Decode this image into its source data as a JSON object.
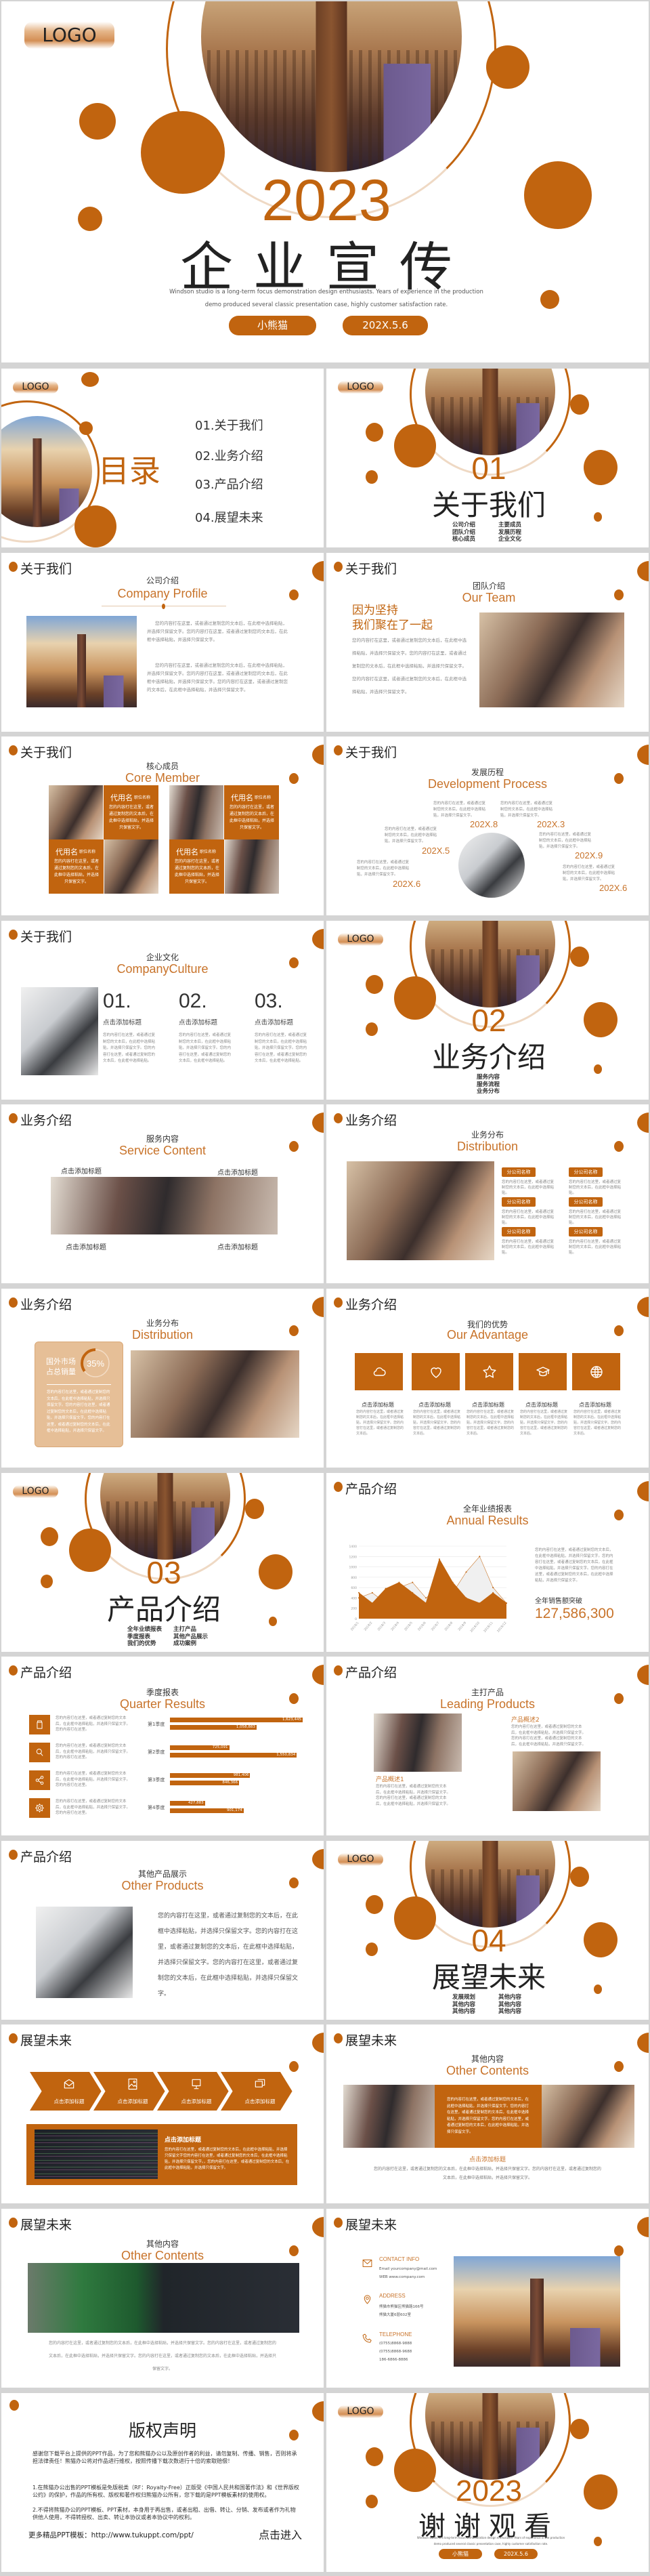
{
  "colors": {
    "accent": "#c1640f",
    "peach": "#e6bf97",
    "text": "#333333",
    "muted": "#8a8a8a"
  },
  "cover": {
    "logo": "LOGO",
    "year": "2023",
    "title": "企业宣传",
    "desc1": "Windson studio is a long-term focus demonstration design enthusiasts. Years of experience in the production",
    "desc2": "demo produced several classic presentation case, highly customer satisfaction rate.",
    "author": "小熊猫",
    "date": "202X.5.6"
  },
  "toc": {
    "logo": "LOGO",
    "title": "目录",
    "items": [
      "01.关于我们",
      "02.业务介绍",
      "03.产品介绍",
      "04.展望未来"
    ]
  },
  "sections": [
    {
      "logo": "LOGO",
      "number": "01",
      "title": "关于我们",
      "items": [
        "公司介绍",
        "团队介绍",
        "核心成员",
        "主要成员",
        "发展历程",
        "企业文化"
      ]
    },
    {
      "logo": "LOGO",
      "number": "02",
      "title": "业务介绍",
      "items": [
        "服务内容",
        "服务流程",
        "业务分布"
      ]
    },
    {
      "logo": "LOGO",
      "number": "03",
      "title": "产品介绍",
      "items": [
        "全年业绩报表",
        "季度报表",
        "我们的优势",
        "主打产品",
        "其他产品展示",
        "成功案例"
      ]
    },
    {
      "logo": "LOGO",
      "number": "04",
      "title": "展望未来",
      "items": [
        "发展规划",
        "其他内容",
        "其他内容",
        "其他内容",
        "其他内容",
        "其他内容"
      ]
    }
  ],
  "slides": {
    "company_profile": {
      "header": "关于我们",
      "cn": "公司介绍",
      "en": "Company Profile",
      "para1": "您的内容打在这里，或者通过复制您的文本后，在此框中选择粘贴，并选择只保留文字。您的内容打在这里，或者通过复制您的文本后，在此框中选择粘贴，并选择只保留文字。",
      "para2": "您的内容打在这里，或者通过复制您的文本后，在此框中选择粘贴，并选择只保留文字。您的内容打在这里，或者通过复制您的文本后，在此框中选择粘贴，并选择只保留文字。您的内容打在这里，或者通过复制您的文本后，在此框中选择粘贴，并选择只保留文字。"
    },
    "team": {
      "header": "关于我们",
      "cn": "团队介绍",
      "en": "Our Team",
      "slogan1": "因为坚持",
      "slogan2": "我们聚在了一起",
      "text": "您的内容打在这里，或者通过复制您的文本后，在此框中选择粘贴，并选择只保留文字。您的内容打在这里，或者通过复制您的文本后，在此框中选择粘贴，并选择只保留文字。您的内容打在这里，或者通过复制您的文本后，在此框中选择粘贴，并选择只保留文字。"
    },
    "core": {
      "header": "关于我们",
      "cn": "核心成员",
      "en": "Core Member",
      "members": [
        {
          "name": "代用名",
          "role": "职位名称",
          "text": "您的内容打在这里，或者通过复制您的文本后，在此框中选择粘贴，并选择只保留文字。"
        },
        {
          "name": "代用名",
          "role": "职位名称",
          "text": "您的内容打在这里，或者通过复制您的文本后，在此框中选择粘贴，并选择只保留文字。"
        },
        {
          "name": "代用名",
          "role": "职位名称",
          "text": "您的内容打在这里，或者通过复制您的文本后，在此框中选择粘贴，并选择只保留文字。"
        },
        {
          "name": "代用名",
          "role": "职位名称",
          "text": "您的内容打在这里，或者通过复制您的文本后，在此框中选择粘贴，并选择只保留文字。"
        }
      ]
    },
    "process": {
      "header": "关于我们",
      "cn": "发展历程",
      "en": "Development Process",
      "events": [
        {
          "date": "202X.8",
          "text": "您的内容打在这里，或者通过复制您的文本后，在此框中选择粘贴，并选择只保留文字。"
        },
        {
          "date": "202X.3",
          "text": "您的内容打在这里，或者通过复制您的文本后，在此框中选择粘贴，并选择只保留文字。"
        },
        {
          "date": "202X.5",
          "text": "您的内容打在这里，或者通过复制您的文本后，在此框中选择粘贴，并选择只保留文字。"
        },
        {
          "date": "202X.9",
          "text": "您的内容打在这里，或者通过复制您的文本后，在此框中选择粘贴，并选择只保留文字。"
        },
        {
          "date": "202X.6",
          "text": "您的内容打在这里，或者通过复制您的文本后，在此框中选择粘贴，并选择只保留文字。"
        },
        {
          "date": "202X.6",
          "text": "您的内容打在这里，或者通过复制您的文本后，在此框中选择粘贴，并选择只保留文字。"
        }
      ]
    },
    "culture": {
      "header": "关于我们",
      "cn": "企业文化",
      "en": "CompanyCulture",
      "items": [
        {
          "num": "01.",
          "title": "点击添加标题",
          "text": "您的内容打在这里，或者通过复制您的文本后，在此框中选择粘贴，并选择只保留文字。您的内容打在这里，或者通过复制您的文本后，在此框中选择粘贴。"
        },
        {
          "num": "02.",
          "title": "点击添加标题",
          "text": "您的内容打在这里，或者通过复制您的文本后，在此框中选择粘贴，并选择只保留文字。您的内容打在这里，或者通过复制您的文本后，在此框中选择粘贴。"
        },
        {
          "num": "03.",
          "title": "点击添加标题",
          "text": "您的内容打在这里，或者通过复制您的文本后，在此框中选择粘贴，并选择只保留文字。您的内容打在这里，或者通过复制您的文本后，在此框中选择粘贴。"
        }
      ]
    },
    "service": {
      "header": "业务介绍",
      "cn": "服务内容",
      "en": "Service Content",
      "labels": [
        "点击添加标题",
        "点击添加标题",
        "点击添加标题",
        "点击添加标题"
      ]
    },
    "dist1": {
      "header": "业务介绍",
      "cn": "业务分布",
      "en": "Distribution",
      "branches": [
        {
          "tag": "分公司名称",
          "text": "您的内容打在这里，或者通过复制您的文本后，在此框中选择粘贴。"
        },
        {
          "tag": "分公司名称",
          "text": "您的内容打在这里，或者通过复制您的文本后，在此框中选择粘贴。"
        },
        {
          "tag": "分公司名称",
          "text": "您的内容打在这里，或者通过复制您的文本后，在此框中选择粘贴。"
        },
        {
          "tag": "分公司名称",
          "text": "您的内容打在这里，或者通过复制您的文本后，在此框中选择粘贴。"
        },
        {
          "tag": "分公司名称",
          "text": "您的内容打在这里，或者通过复制您的文本后，在此框中选择粘贴。"
        },
        {
          "tag": "分公司名称",
          "text": "您的内容打在这里，或者通过复制您的文本后，在此框中选择粘贴。"
        }
      ]
    },
    "dist2": {
      "header": "业务介绍",
      "cn": "业务分布",
      "en": "Distribution",
      "label1": "国外市场",
      "label2": "占总销量",
      "percent": "35%",
      "percent_value": 35,
      "text": "您的内容打在这里，或者通过复制您的文本后，在此框中选择粘贴，并选择只保留文字。您的内容打在这里，或者通过复制您的文本后，在此框中选择粘贴，并选择只保留文字。您的内容打在这里，或者通过复制您的文本后，在此框中选择粘贴，并选择只保留文字。"
    },
    "advantage": {
      "header": "业务介绍",
      "cn": "我们的优势",
      "en": "Our Advantage",
      "items": [
        {
          "icon": "cloud-icon",
          "title": "点击添加标题",
          "text": "您的内容打在这里，或者通过复制您的文本后，在此框中选择粘贴，并选择只保留文字。您的内容打在这里，或者通过复制您的文本后。"
        },
        {
          "icon": "heart-icon",
          "title": "点击添加标题",
          "text": "您的内容打在这里，或者通过复制您的文本后，在此框中选择粘贴，并选择只保留文字。您的内容打在这里，或者通过复制您的文本后。"
        },
        {
          "icon": "star-icon",
          "title": "点击添加标题",
          "text": "您的内容打在这里，或者通过复制您的文本后，在此框中选择粘贴，并选择只保留文字。您的内容打在这里，或者通过复制您的文本后。"
        },
        {
          "icon": "graduation-cap-icon",
          "title": "点击添加标题",
          "text": "您的内容打在这里，或者通过复制您的文本后，在此框中选择粘贴，并选择只保留文字。您的内容打在这里，或者通过复制您的文本后。"
        },
        {
          "icon": "globe-icon",
          "title": "点击添加标题",
          "text": "您的内容打在这里，或者通过复制您的文本后，在此框中选择粘贴，并选择只保留文字。您的内容打在这里，或者通过复制您的文本后。"
        }
      ]
    },
    "annual": {
      "header": "产品介绍",
      "cn": "全年业绩报表",
      "en": "Annual Results",
      "text": "您的内容打在这里，或者通过复制您的文本后，在此框中选择粘贴，并选择只保留文字。您的内容打在这里，或者通过复制您的文本后，在此框中选择粘贴，并选择只保留文字。您的内容打在这里，或者通过复制您的文本后，在此框中选择粘贴，并选择只保留文字。",
      "sales_label": "全年销售额突破",
      "sales_value": "127,586,300"
    },
    "quarter": {
      "header": "产品介绍",
      "cn": "季度报表",
      "en": "Quarter Results",
      "rows": [
        {
          "icon": "jar-icon",
          "text": "您的内容打在这里，或者通过复制您的文本后，在此框中选择粘贴，并选择只保留文字。您的内容打在这里。",
          "label": "第1季度",
          "a": "1,623,445",
          "b": "1,058,883"
        },
        {
          "icon": "search-icon",
          "text": "您的内容打在这里，或者通过复制您的文本后，在此框中选择粘贴，并选择只保留文字。您的内容打在这里。",
          "label": "第2季度",
          "a": "725,091",
          "b": "1,550,834"
        },
        {
          "icon": "share-icon",
          "text": "您的内容打在这里，或者通过复制您的文本后，在此框中选择粘贴，并选择只保留文字。您的内容打在这里。",
          "label": "第3季度",
          "a": "981,406",
          "b": "846,366"
        },
        {
          "icon": "gear-icon",
          "text": "您的内容打在这里，或者通过复制您的文本后，在此框中选择粘贴，并选择只保留文字。您的内容打在这里。",
          "label": "第4季度",
          "a": "427,883",
          "b": "901,174"
        }
      ]
    },
    "leading": {
      "header": "产品介绍",
      "cn": "主打产品",
      "en": "Leading Products",
      "p1_title": "产品概述1",
      "p1_text": "您的内容打在这里，或者通过复制您的文本后，在此框中选择粘贴，并选择只保留文字。您的内容打在这里，或者通过复制您的文本后，在此框中选择粘贴，并选择只保留文字。",
      "p2_title": "产品概述2",
      "p2_text": "您的内容打在这里，或者通过复制您的文本后，在此框中选择粘贴，并选择只保留文字。您的内容打在这里，或者通过复制您的文本后，在此框中选择粘贴，并选择只保留文字。"
    },
    "other_products": {
      "header": "产品介绍",
      "cn": "其他产品展示",
      "en": "Other Products",
      "text": "您的内容打在这里，或者通过复制您的文本后，在此框中选择粘贴，并选择只保留文字。您的内容打在这里，或者通过复制您的文本后，在此框中选择粘贴，并选择只保留文字。您的内容打在这里，或者通过复制您的文本后，在此框中选择粘贴，并选择只保留文字。"
    },
    "future_steps": {
      "header": "展望未来",
      "steps": [
        {
          "icon": "mail-icon",
          "label": "点击添加标题"
        },
        {
          "icon": "image-icon",
          "label": "点击添加标题"
        },
        {
          "icon": "monitor-icon",
          "label": "点击添加标题"
        },
        {
          "icon": "chat-icon",
          "label": "点击添加标题"
        }
      ],
      "box_title": "点击添加标题",
      "box_text": "您的内容打在这里，或者通过复制您的文本后，在此框中选择粘贴，并选择只保留文字您的内容打在这里，或者通过复制您的文本后，在此框中选择粘贴，并选择只保留文字。，您的内容打在这里，或者通过复制您的文本后，在此框中选择粘贴，并选择只保留文字。"
    },
    "other_contents1": {
      "header": "展望未来",
      "cn": "其他内容",
      "en": "Other Contents",
      "card_text": "您的内容打在这里，或者通过复制您的文本后，在此框中选择粘贴，并选择只保留文字。您的内容打在这里，或者通过复制您的文本后，在此框中选择粘贴，并选择只保留文字。您的内容打在这里，或者通过复制您的文本后，在此框中选择粘贴，并选择只保留文字。",
      "title": "点击添加标题",
      "text": "您的内容打在这里，或者通过复制您的文本后，在此框中选择粘贴，并选择只保留文字。您的内容打在这里，或者通过复制您的文本后，在此框中选择粘贴，并选择只保留文字。"
    },
    "other_contents2": {
      "header": "展望未来",
      "cn": "其他内容",
      "en": "Other Contents",
      "text": "您的内容打在这里，或者通过复制您的文本后，在此框中选择粘贴，并选择只保留文字。您的内容打在这里，或者通过复制您的文本后，在此框中选择粘贴，并选择只保留文字。您的内容打在这里，或者通过复制您的文本后，在此框中选择粘贴，并选择只保留文字。"
    },
    "contact": {
      "header": "展望未来",
      "contact_label": "CONTACT INFO",
      "email": "Email yourcompany@mail.com",
      "web": "WEB www.company.com",
      "address_label": "ADDRESS",
      "addr1": "熊猫市熊猫区熊猫路166号",
      "addr2": "熊猫大厦6层602室",
      "tel_label": "TELEPHONE",
      "tel1": "(0755)8868-9888",
      "tel2": "(0755)8868-9688",
      "tel3": "186-6866-8886"
    },
    "copyright": {
      "title": "版权声明",
      "p1": "感谢您下载平台上提供的PPT作品，为了您和熊猫办公以及原创作者的利益，请勿复制、传播、销售，否则将承担法律责任！熊猫办公将对作品进行维权，按照传播下载次数进行十倍的索取赔偿！",
      "p2": "1.在熊猫办公出售的PPT模板是免版税类（RF：Royalty-Free）正版受《中国人民共和国著作法》和《世界版权公约》的保护，作品的所有权、版权和著作权归熊猫办公所有，您下载的是PPT模板素材的使用权。",
      "p3": "2.不得将熊猫办公的PPT模板、PPT素材，本身用于再出售，或者出租、出借、转让、分销、发布或者作为礼物供他人使用，不得转授权、出卖、转让本协议或者本协议中的权利。",
      "more": "更多精品PPT模板：http://www.tukuppt.com/ppt/",
      "enter": "点击进入"
    },
    "thanks": {
      "logo": "LOGO",
      "year": "2023",
      "title": "谢谢观看",
      "desc1": "Windson studio is a long-term focus demonstration design enthusiasts. Years of experience in the production",
      "desc2": "demo produced several classic presentation case, highly customer satisfaction rate.",
      "author": "小熊猫",
      "date": "202X.5.6"
    }
  },
  "chart_data": [
    {
      "type": "area",
      "x": [
        "2018/1",
        "2018/2",
        "2018/3",
        "2018/4",
        "2018/5",
        "2018/6",
        "2018/7",
        "2018/8",
        "2018/9",
        "2018/10",
        "2018/11",
        "2018/12"
      ],
      "series": [
        {
          "values": [
            400,
            500,
            300,
            600,
            700,
            400,
            600,
            500,
            900,
            1200,
            600,
            300
          ],
          "color": "#f0f0f0"
        },
        {
          "values": [
            500,
            300,
            580,
            700,
            500,
            300,
            1150,
            700,
            400,
            300,
            500,
            300
          ],
          "color": "#c1640f"
        }
      ],
      "ylim": [
        0,
        1400
      ],
      "yticks": [
        0,
        200,
        400,
        600,
        800,
        1000,
        1200,
        1400
      ],
      "grid": true
    },
    {
      "type": "bar",
      "orientation": "horizontal",
      "categories": [
        "第1季度",
        "第2季度",
        "第3季度",
        "第4季度"
      ],
      "series": [
        {
          "values": [
            1623445,
            725091,
            981406,
            427883
          ]
        },
        {
          "values": [
            1058883,
            1550834,
            846366,
            901174
          ]
        }
      ]
    }
  ]
}
